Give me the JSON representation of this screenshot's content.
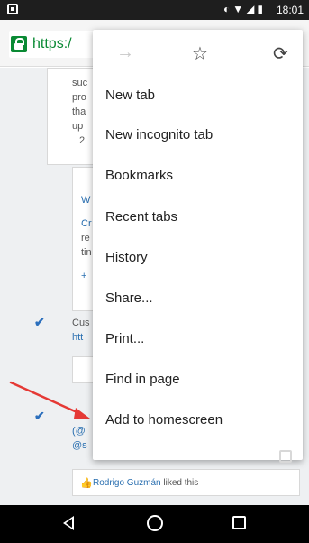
{
  "status_bar": {
    "time": "18:01"
  },
  "url_bar": {
    "url": "https:/"
  },
  "background_page": {
    "text_fragments": [
      "suc",
      "pro",
      "tha",
      "up",
      "2",
      "W",
      "Cr",
      "re",
      "tin",
      "+",
      "Cus",
      "htt",
      "(@",
      "@s"
    ],
    "footer_liked": {
      "name": "Rodrigo Guzmán",
      "rest": " liked this"
    }
  },
  "menu": {
    "top_icons": [
      "forward-icon",
      "star-icon",
      "reload-icon"
    ],
    "items": [
      {
        "label": "New tab"
      },
      {
        "label": "New incognito tab"
      },
      {
        "label": "Bookmarks"
      },
      {
        "label": "Recent tabs"
      },
      {
        "label": "History"
      },
      {
        "label": "Share..."
      },
      {
        "label": "Print..."
      },
      {
        "label": "Find in page"
      },
      {
        "label": "Add to homescreen"
      }
    ]
  },
  "nav_bar": {
    "buttons": [
      "back",
      "home",
      "recents"
    ]
  }
}
